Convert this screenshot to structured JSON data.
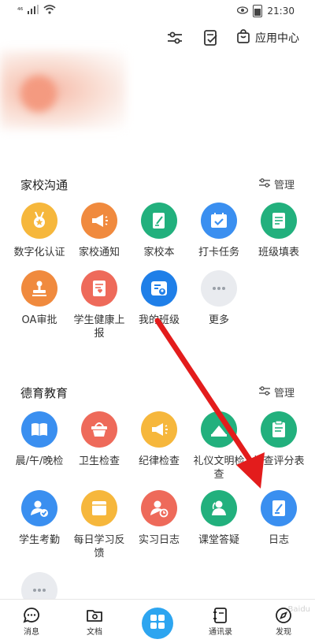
{
  "status_bar": {
    "signal": "⁴⁶",
    "time": "21:30"
  },
  "header": {
    "app_center_label": "应用中心"
  },
  "section_home_school": {
    "title": "家校沟通",
    "manage_label": "管理",
    "apps": [
      {
        "label": "数字化认证",
        "color": "#f6b73c",
        "icon": "medal-icon"
      },
      {
        "label": "家校通知",
        "color": "#f08a3e",
        "icon": "megaphone-icon"
      },
      {
        "label": "家校本",
        "color": "#22b07d",
        "icon": "notebook-icon"
      },
      {
        "label": "打卡任务",
        "color": "#3a8ff0",
        "icon": "calendar-check-icon"
      },
      {
        "label": "班级填表",
        "color": "#22b07d",
        "icon": "form-icon"
      },
      {
        "label": "OA审批",
        "color": "#f08a3e",
        "icon": "stamp-icon"
      },
      {
        "label": "学生健康上报",
        "color": "#ee6a5a",
        "icon": "health-report-icon"
      },
      {
        "label": "我的班级",
        "color": "#1f7fe8",
        "icon": "class-icon"
      },
      {
        "label": "更多",
        "color": "#e9ebef",
        "icon": "more-icon"
      }
    ]
  },
  "section_moral": {
    "title": "德育教育",
    "manage_label": "管理",
    "apps": [
      {
        "label": "晨/午/晚检",
        "color": "#3a8ff0",
        "icon": "book-icon"
      },
      {
        "label": "卫生检查",
        "color": "#ee6a5a",
        "icon": "basket-icon"
      },
      {
        "label": "纪律检查",
        "color": "#f6b73c",
        "icon": "megaphone-icon"
      },
      {
        "label": "礼仪文明检查",
        "color": "#22b07d",
        "icon": "etiquette-icon"
      },
      {
        "label": "检查评分表",
        "color": "#22b07d",
        "icon": "clipboard-icon"
      },
      {
        "label": "学生考勤",
        "color": "#3a8ff0",
        "icon": "attendance-icon"
      },
      {
        "label": "每日学习反馈",
        "color": "#f6b73c",
        "icon": "feedback-icon"
      },
      {
        "label": "实习日志",
        "color": "#ee6a5a",
        "icon": "intern-log-icon"
      },
      {
        "label": "课堂答疑",
        "color": "#22b07d",
        "icon": "qa-icon"
      },
      {
        "label": "日志",
        "color": "#3a8ff0",
        "icon": "log-icon"
      },
      {
        "label": "",
        "color": "#e9ebef",
        "icon": "more-icon"
      }
    ]
  },
  "bottom_nav": {
    "items": [
      {
        "label": "消息",
        "icon": "message-icon"
      },
      {
        "label": "文档",
        "icon": "folder-icon"
      },
      {
        "label": "",
        "icon": "grid-icon"
      },
      {
        "label": "通讯录",
        "icon": "contacts-icon"
      },
      {
        "label": "发现",
        "icon": "discover-icon"
      }
    ]
  },
  "colors": {
    "accent_blue": "#2da5f0",
    "annotation_red": "#e31c1c"
  }
}
